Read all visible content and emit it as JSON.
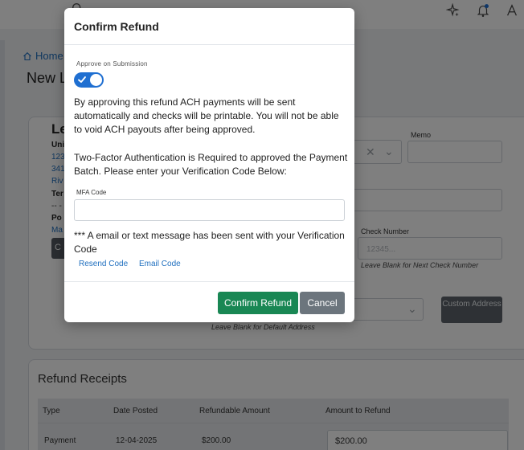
{
  "topbar": {
    "search_icon": "search-icon",
    "sparkle_icon": "sparkle-icon",
    "bell_icon": "bell-icon",
    "user_icon": "user-icon",
    "notification_color": "#1f6fd1"
  },
  "breadcrumb": {
    "home_label": "Home",
    "home_icon": "home-icon"
  },
  "page": {
    "title_fragment": "New Le"
  },
  "lender_card": {
    "title_fragment": "Le",
    "fragments": [
      "Uni",
      "123",
      "341",
      "Riv",
      "Ter",
      "-- -",
      "Po",
      "Ma"
    ],
    "button_fragment": "C"
  },
  "form": {
    "memo_label": "Memo",
    "check_number_label": "Check Number",
    "check_number_placeholder": "12345...",
    "check_number_help": "Leave Blank for Next Check Number",
    "address_help": "Leave Blank for Default Address",
    "custom_address_button": "Custom Address"
  },
  "receipts": {
    "title": "Refund Receipts",
    "columns": [
      "Type",
      "Date Posted",
      "Refundable Amount",
      "Amount to Refund"
    ],
    "rows": [
      {
        "type": "Payment",
        "date_posted": "12-04-2025",
        "refundable_amount": "$200.00",
        "amount_to_refund": "$200.00"
      }
    ]
  },
  "modal": {
    "title": "Confirm Refund",
    "approve_label": "Approve on Submission",
    "approve_on": true,
    "ach_notice": "By approving this refund ACH payments will be sent automatically and checks will be printable. You will not be able to void ACH payouts after being approved.",
    "two_factor_notice": "Two-Factor Authentication is Required to approved the Payment Batch. Please enter your Verification Code Below:",
    "mfa_label": "MFA Code",
    "mfa_value": "",
    "sent_notice": "*** A email or text message has been sent with your Verification Code",
    "resend_label": "Resend Code",
    "email_label": "Email Code",
    "confirm_label": "Confirm Refund",
    "cancel_label": "Cancel",
    "confirm_color": "#198754",
    "cancel_color": "#6c757d",
    "toggle_color": "#1f6fd1"
  }
}
